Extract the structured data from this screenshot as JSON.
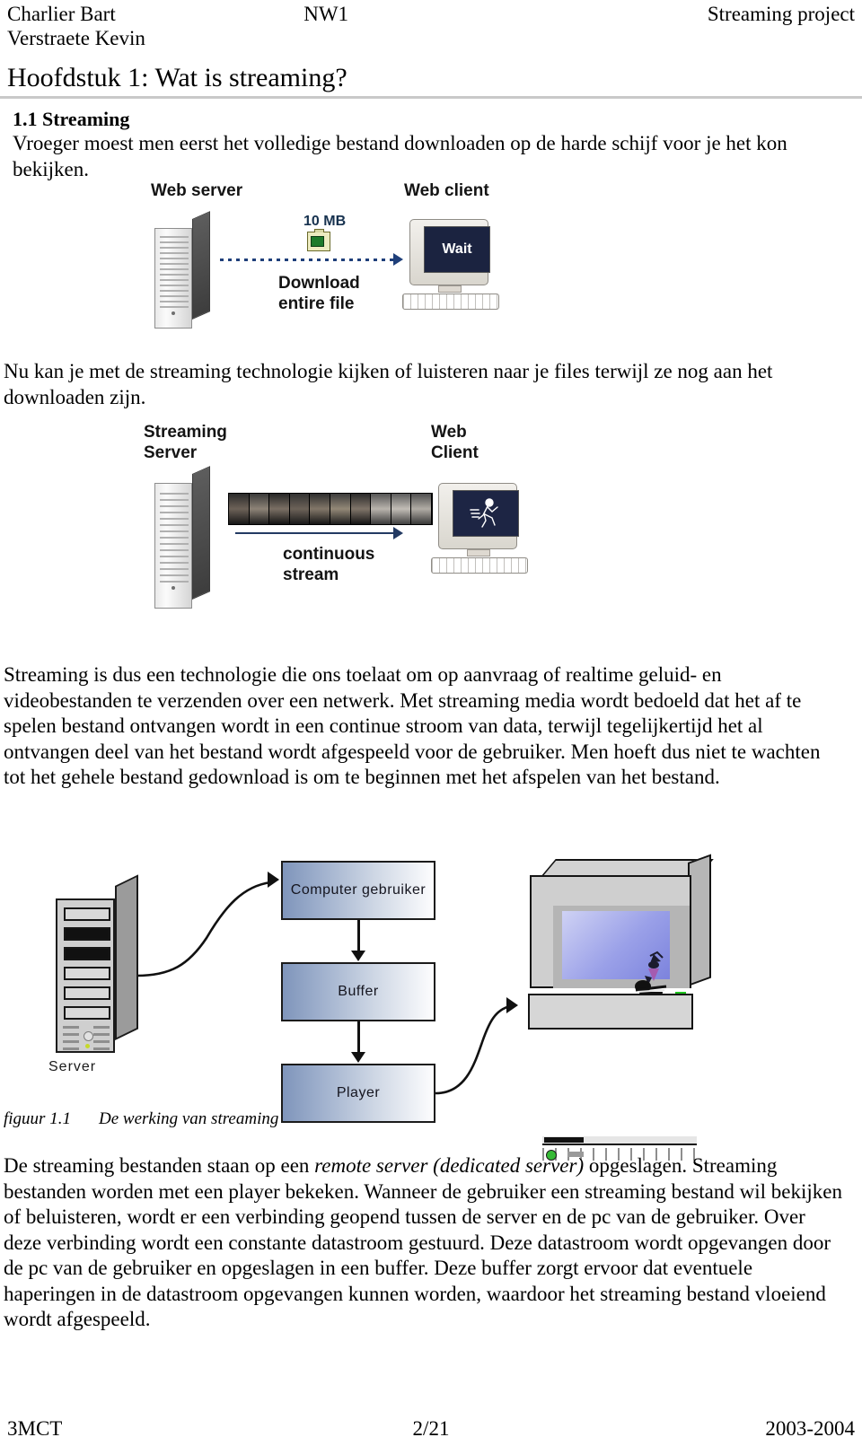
{
  "header": {
    "author1": "Charlier Bart",
    "author2": "Verstraete Kevin",
    "course": "NW1",
    "project": "Streaming project"
  },
  "chapter_title": "Hoofdstuk 1: Wat is streaming?",
  "section": {
    "number_title": "1.1 Streaming",
    "paragraph1": "Vroeger moest men eerst het volledige bestand downloaden op de harde schijf voor je het kon bekijken.",
    "paragraph2": "Nu kan je met de streaming technologie kijken of luisteren naar je files terwijl ze nog aan het downloaden zijn.",
    "paragraph3": "Streaming is dus een technologie die ons toelaat om op aanvraag of realtime geluid- en videobestanden te verzenden over een netwerk. Met streaming media wordt bedoeld dat het af te spelen bestand ontvangen wordt in een continue stroom van data, terwijl tegelijkertijd het al ontvangen deel van het bestand wordt afgespeeld voor de gebruiker. Men hoeft dus niet te wachten tot het gehele bestand gedownload is om te beginnen met het afspelen van het bestand."
  },
  "figure1": {
    "server_label": "Web server",
    "client_label": "Web client",
    "file_size": "10 MB",
    "transfer_label_line1": "Download",
    "transfer_label_line2": "entire file",
    "screen_text": "Wait"
  },
  "figure2": {
    "server_label_line1": "Streaming",
    "server_label_line2": "Server",
    "client_label_line1": "Web",
    "client_label_line2": "Client",
    "stream_label_line1": "continuous",
    "stream_label_line2": "stream"
  },
  "figure3": {
    "server_label": "Server",
    "box_user": "Computer gebruiker",
    "box_buffer": "Buffer",
    "box_player": "Player"
  },
  "caption": {
    "number": "figuur 1.1",
    "text": "De werking van streaming"
  },
  "body": {
    "final_part1": "De streaming bestanden staan op een ",
    "final_italic": "remote server (dedicated server)",
    "final_part2": " opgeslagen. Streaming bestanden worden met een player bekeken. Wanneer de gebruiker een streaming bestand wil bekijken of beluisteren, wordt er een verbinding geopend tussen de server en de pc van de gebruiker. Over deze verbinding wordt een constante datastroom gestuurd. Deze datastroom wordt opgevangen door de pc van de gebruiker en opgeslagen in een buffer. Deze buffer zorgt ervoor dat eventuele haperingen in de datastroom opgevangen kunnen worden, waardoor het streaming bestand vloeiend wordt afgespeeld."
  },
  "footer": {
    "left": "3MCT",
    "center": "2/21",
    "right": "2003-2004"
  },
  "colors": {
    "rule": "#c9c9c9",
    "box_gradient_start": "#7f95bb",
    "box_gradient_end": "#fdfdfe",
    "arrow_fig1": "#1f3f7a"
  }
}
